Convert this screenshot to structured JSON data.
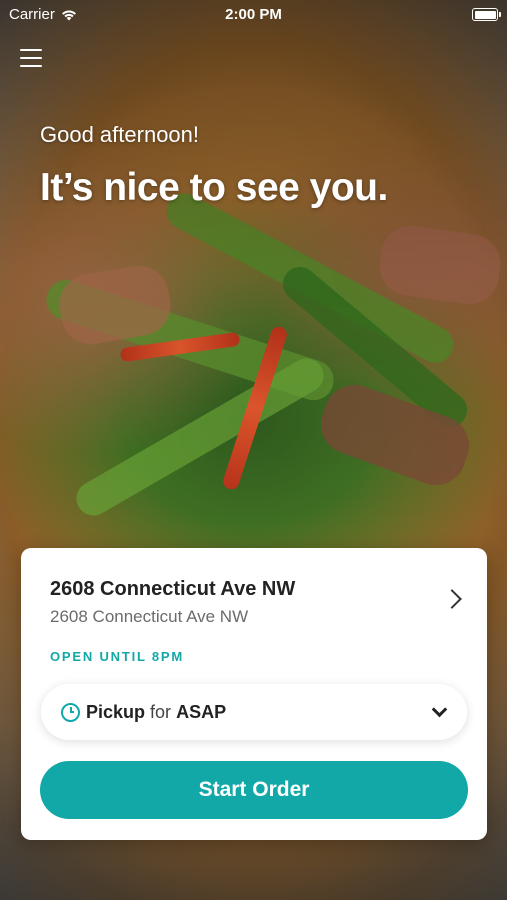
{
  "status_bar": {
    "carrier": "Carrier",
    "time": "2:00 PM"
  },
  "hero": {
    "greeting": "Good afternoon!",
    "headline": "It’s nice to see you."
  },
  "location_card": {
    "title": "2608 Connecticut Ave NW",
    "address": "2608 Connecticut Ave NW",
    "hours": "OPEN UNTIL 8PM",
    "order_type": "Pickup",
    "order_for": "for",
    "order_time": "ASAP",
    "start_button": "Start Order"
  },
  "colors": {
    "accent": "#12a8a8"
  }
}
